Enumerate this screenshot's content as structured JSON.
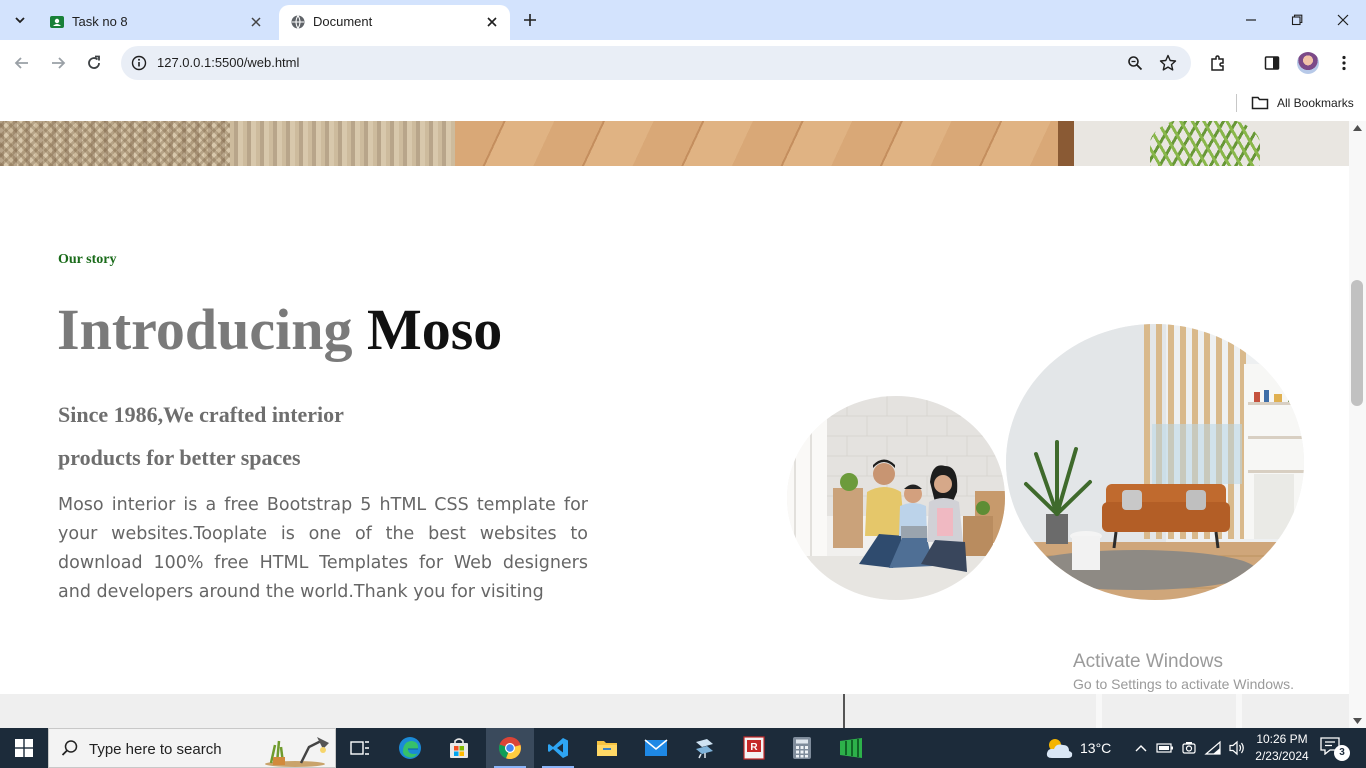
{
  "browser": {
    "tabs": [
      {
        "title": "Task no 8",
        "favicon": "google-classroom-icon",
        "active": false
      },
      {
        "title": "Document",
        "favicon": "globe-icon",
        "active": true
      }
    ],
    "url": "127.0.0.1:5500/web.html",
    "bookmarks_label": "All Bookmarks"
  },
  "page": {
    "story_label": "Our story",
    "headline_grey": "Introducing",
    "headline_dark": "Moso",
    "subhead": "Since 1986,We crafted interior products for better spaces",
    "paragraph": "Moso interior is a free Bootstrap 5 hTML CSS template for your websites.Tooplate is one of the best websites to download 100% free HTML Templates for Web designers and developers around the world.Thank you for visiting",
    "images": [
      "family-photo",
      "living-room-photo"
    ]
  },
  "watermark": {
    "title": "Activate Windows",
    "subtitle": "Go to Settings to activate Windows."
  },
  "taskbar": {
    "search_placeholder": "Type here to search",
    "apps": [
      "task-view-icon",
      "edge-icon",
      "store-icon",
      "chrome-icon",
      "vscode-icon",
      "file-explorer-icon",
      "mail-icon",
      "network-app-icon",
      "pdf-app-icon",
      "calculator-icon",
      "spreadsheet-app-icon"
    ],
    "weather": "13°C",
    "time": "10:26 PM",
    "date": "2/23/2024",
    "notifications": "3"
  },
  "colors": {
    "tabstrip": "#d3e3fd",
    "omnibox": "#e9eef6",
    "story_green": "#1a6b1a",
    "headline_grey": "#7a7a7a",
    "taskbar": "#1c2b3a"
  }
}
